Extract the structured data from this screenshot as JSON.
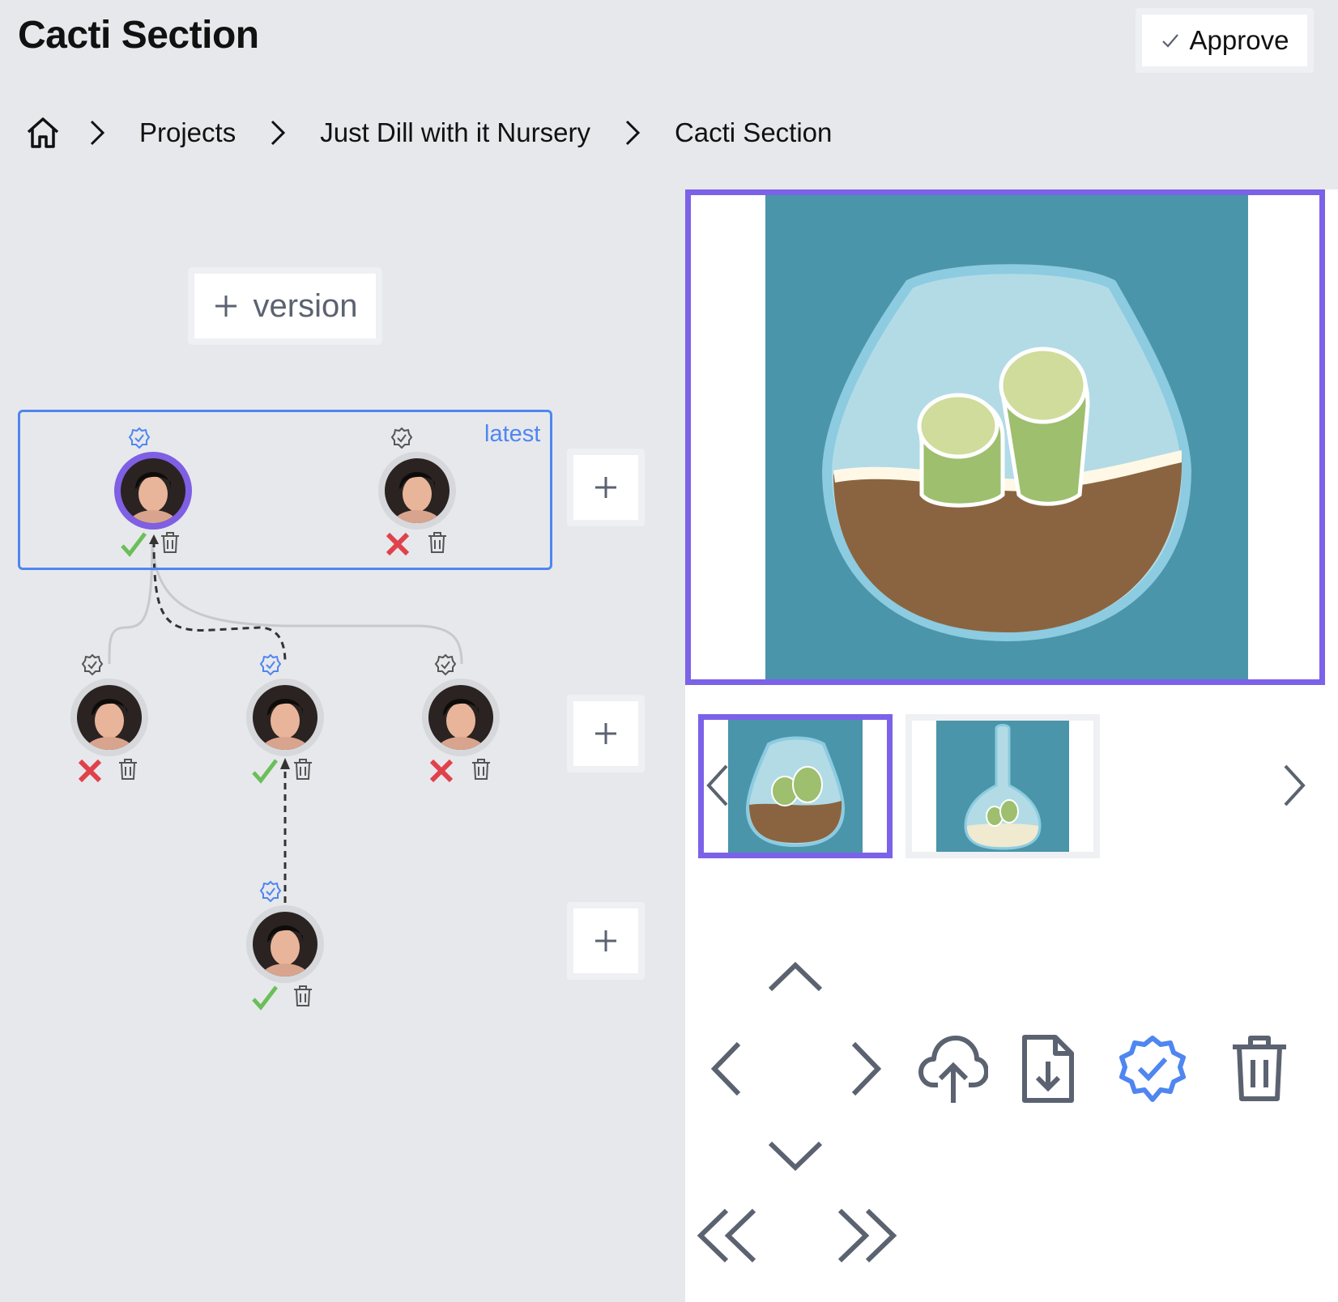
{
  "header": {
    "title": "Cacti Section",
    "approve_label": "Approve"
  },
  "breadcrumb": {
    "items": [
      "Projects",
      "Just Dill with it Nursery",
      "Cacti Section"
    ]
  },
  "versions": {
    "add_label": "version",
    "latest_label": "latest"
  },
  "colors": {
    "accent": "#7b62e8",
    "link_blue": "#4f86f0",
    "approved": "#6bbf59",
    "rejected": "#e0424b",
    "icon_gray": "#5b6270"
  }
}
